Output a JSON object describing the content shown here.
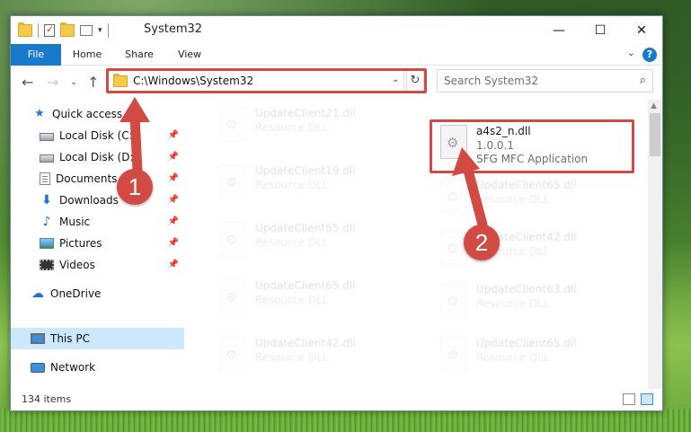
{
  "window": {
    "title": "System32"
  },
  "ribbon": {
    "tabs": [
      "File",
      "Home",
      "Share",
      "View"
    ]
  },
  "address": {
    "path": "C:\\Windows\\System32"
  },
  "search": {
    "placeholder": "Search System32"
  },
  "sidebar": {
    "items": [
      {
        "label": "Quick access",
        "icon": "star-icon"
      },
      {
        "label": "Local Disk (C:)",
        "icon": "drive-icon",
        "pinned": true
      },
      {
        "label": "Local Disk (D:)",
        "icon": "drive-icon",
        "pinned": true
      },
      {
        "label": "Documents",
        "icon": "documents-icon",
        "pinned": true
      },
      {
        "label": "Downloads",
        "icon": "download-icon",
        "pinned": true
      },
      {
        "label": "Music",
        "icon": "music-icon",
        "pinned": true
      },
      {
        "label": "Pictures",
        "icon": "pictures-icon",
        "pinned": true
      },
      {
        "label": "Videos",
        "icon": "videos-icon",
        "pinned": true
      },
      {
        "label": "OneDrive",
        "icon": "cloud-icon"
      },
      {
        "label": "This PC",
        "icon": "pc-icon",
        "selected": true
      },
      {
        "label": "Network",
        "icon": "network-icon"
      }
    ]
  },
  "files": {
    "left": [
      {
        "name": "UpdateClient21.dll",
        "type": "Resource DLL"
      },
      {
        "name": "UpdateClient19.dll",
        "type": "Resource DLL"
      },
      {
        "name": "UpdateClient65.dll",
        "type": "Resource DLL"
      },
      {
        "name": "UpdateClient65.dll",
        "type": "Resource DLL"
      },
      {
        "name": "UpdateClient42.dll",
        "type": "Resource DLL"
      }
    ],
    "right": [
      {
        "name": "UpdateClient65.dll",
        "type": "Resource DLL"
      },
      {
        "name": "UpdateClient42.dll",
        "type": "Resource DLL"
      },
      {
        "name": "UpdateClient63.dll",
        "type": "Resource DLL"
      },
      {
        "name": "UpdateClient65.dll",
        "type": "Resource DLL"
      }
    ],
    "highlighted": {
      "name": "a4s2_n.dll",
      "version": "1.0.0.1",
      "description": "SFG MFC Application"
    }
  },
  "status": {
    "item_count": "134 items"
  },
  "annotations": {
    "step1": "1",
    "step2": "2",
    "color": "#d24a44"
  }
}
